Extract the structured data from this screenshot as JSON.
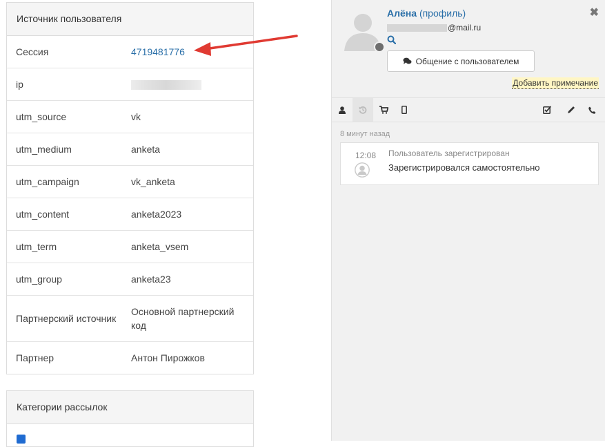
{
  "source_panel": {
    "title": "Источник пользователя",
    "rows": [
      {
        "key": "Сессия",
        "value": "4719481776"
      },
      {
        "key": "ip",
        "value": ""
      },
      {
        "key": "utm_source",
        "value": "vk"
      },
      {
        "key": "utm_medium",
        "value": "anketa"
      },
      {
        "key": "utm_campaign",
        "value": "vk_anketa"
      },
      {
        "key": "utm_content",
        "value": "anketa2023"
      },
      {
        "key": "utm_term",
        "value": "anketa_vsem"
      },
      {
        "key": "utm_group",
        "value": "anketa23"
      },
      {
        "key": "Партнерский источник",
        "value": "Основной партнерский код"
      },
      {
        "key": "Партнер",
        "value": "Антон Пирожков"
      }
    ]
  },
  "mailing_panel": {
    "title": "Категории рассылок"
  },
  "profile": {
    "name": "Алёна",
    "profile_link": "(профиль)",
    "email_suffix": "@mail.ru",
    "chat_button": "Общение с пользователем",
    "add_note": "Добавить примечание"
  },
  "timeline": {
    "ago": "8 минут назад",
    "events": [
      {
        "time": "12:08",
        "title": "Пользователь зарегистрирован",
        "desc": "Зарегистрировался самостоятельно"
      }
    ]
  },
  "colors": {
    "link": "#2a6fa8",
    "arrow": "#e03a32",
    "checkbox": "#1f6bd1"
  }
}
